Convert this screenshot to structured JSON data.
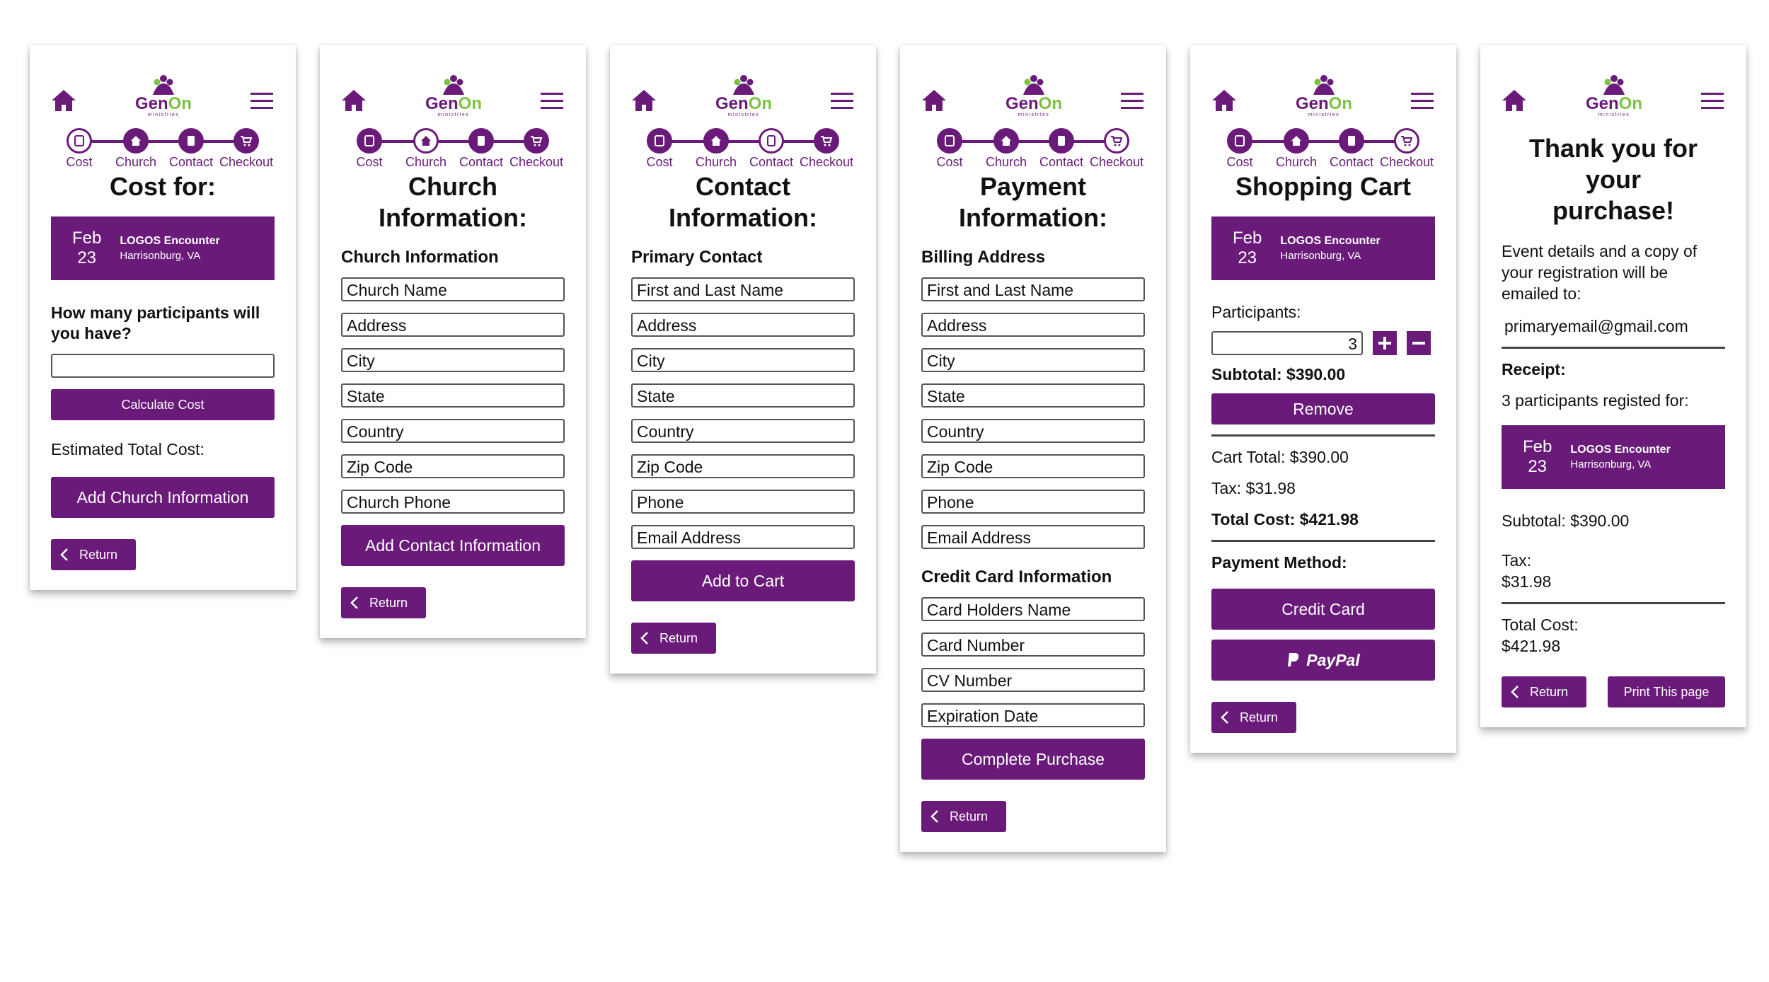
{
  "brand": {
    "logo_text": "GenOn",
    "logo_subtext": "ministries",
    "color_primary": "#6a1b7a",
    "color_accent": "#7cc242"
  },
  "steps": [
    "Cost",
    "Church",
    "Contact",
    "Checkout"
  ],
  "event": {
    "month": "Feb",
    "day": "23",
    "name": "LOGOS Encounter",
    "location": "Harrisonburg, VA"
  },
  "return_label": "Return",
  "screen1": {
    "title": "Cost for:",
    "question": "How many participants will you have?",
    "participants_value": "",
    "calculate_button": "Calculate Cost",
    "estimate_label": "Estimated Total Cost:",
    "next_button": "Add Church Information"
  },
  "screen2": {
    "title": "Church Information:",
    "section": "Church Information",
    "fields": [
      "Church Name",
      "Address",
      "City",
      "State",
      "Country",
      "Zip Code",
      "Church Phone"
    ],
    "next_button": "Add Contact Information"
  },
  "screen3": {
    "title": "Contact Information:",
    "section": "Primary Contact",
    "fields": [
      "First and Last Name",
      "Address",
      "City",
      "State",
      "Country",
      "Zip Code",
      "Phone",
      "Email Address"
    ],
    "next_button": "Add to Cart"
  },
  "screen4": {
    "title": "Payment Information:",
    "section": "Billing Address",
    "fields": [
      "First and Last Name",
      "Address",
      "City",
      "State",
      "Country",
      "Zip Code",
      "Phone",
      "Email Address"
    ],
    "card_section": "Credit Card Information",
    "card_fields": [
      "Card Holders Name",
      "Card Number",
      "CV Number",
      "Expiration Date"
    ],
    "next_button": "Complete Purchase"
  },
  "screen5": {
    "title": "Shopping Cart",
    "participants_label": "Participants:",
    "participants_value": "3",
    "subtotal": "Subtotal: $390.00",
    "remove_button": "Remove",
    "cart_total": "Cart Total: $390.00",
    "tax": "Tax: $31.98",
    "total_cost": "Total Cost: $421.98",
    "payment_method_label": "Payment Method:",
    "credit_card_button": "Credit Card",
    "paypal_label": "PayPal"
  },
  "screen6": {
    "title": "Thank you for your purchase!",
    "message": "Event details and a copy of your registration will be emailed to:",
    "email": "primaryemail@gmail.com",
    "receipt_label": "Receipt:",
    "receipt_text": "3 participants registed for:",
    "subtotal": "Subtotal: $390.00",
    "tax_label": "Tax:",
    "tax_value": "$31.98",
    "total_label": "Total Cost:",
    "total_value": "$421.98",
    "print_button": "Print This page"
  }
}
